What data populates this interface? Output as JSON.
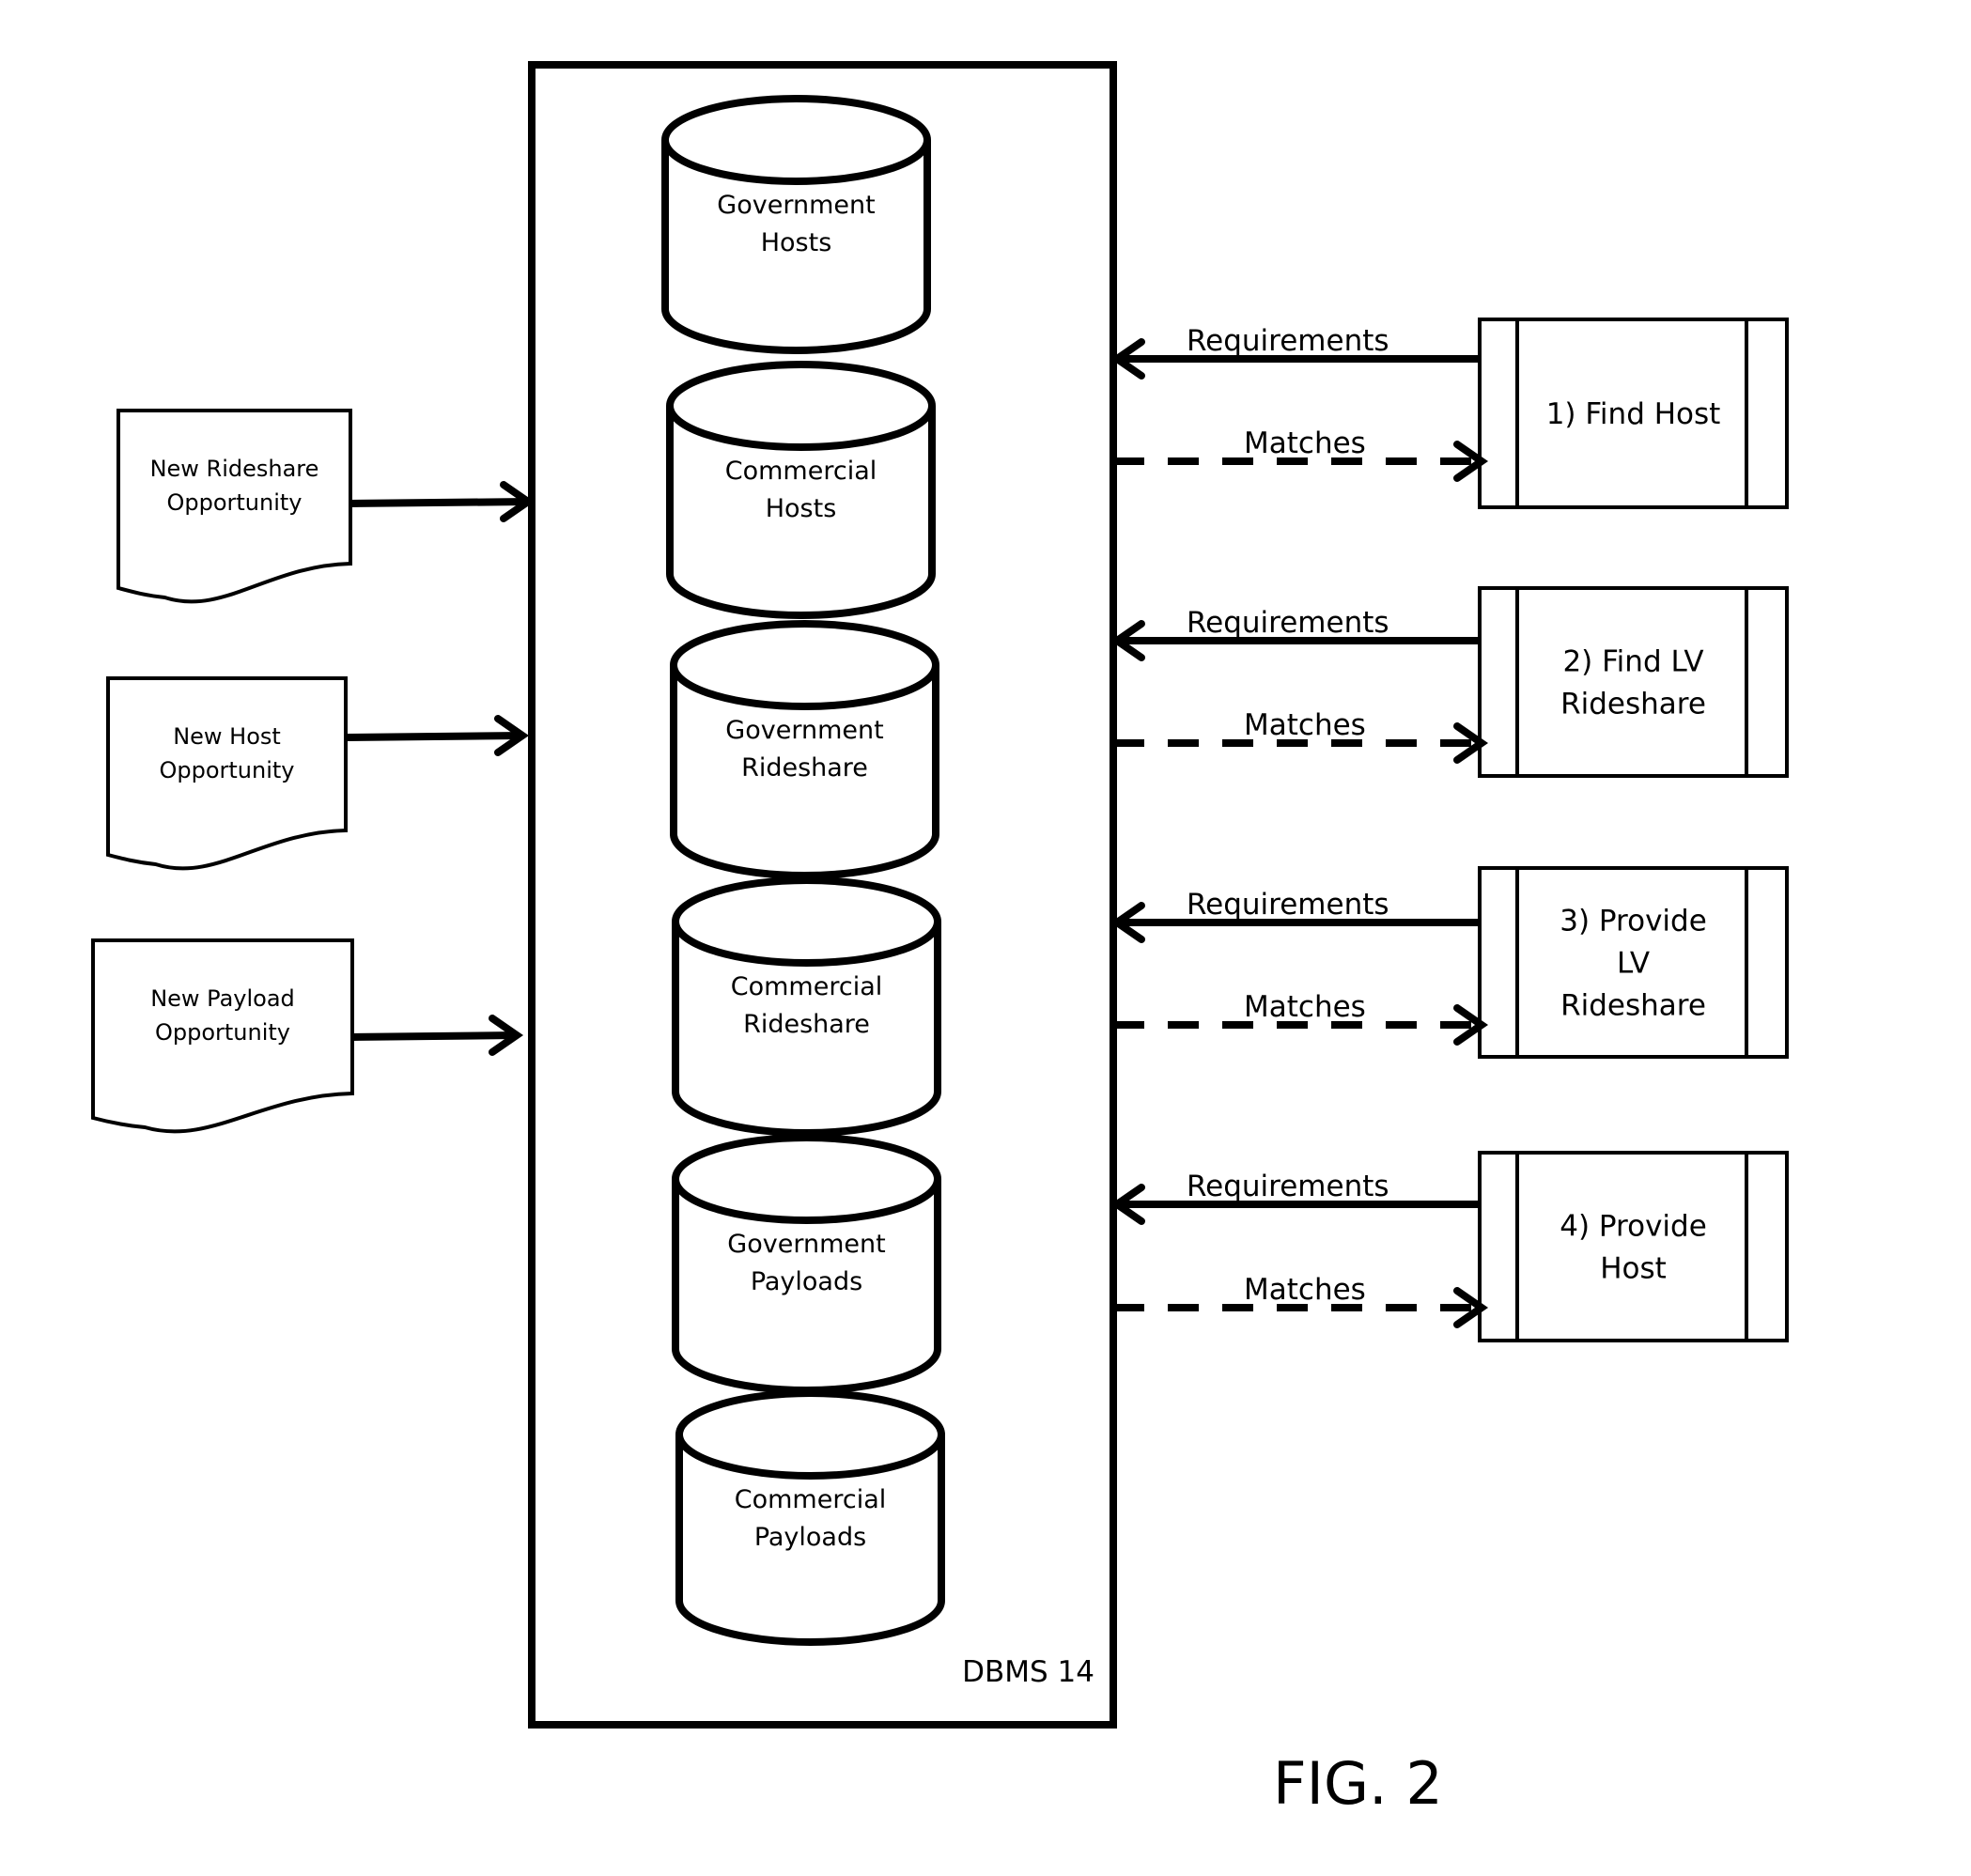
{
  "figure_label": "FIG. 2",
  "dbms": {
    "label": "DBMS 14",
    "databases": [
      {
        "name": "Government Hosts",
        "lines": [
          "Government",
          "Hosts"
        ]
      },
      {
        "name": "Commercial Hosts",
        "lines": [
          "Commercial",
          "Hosts"
        ]
      },
      {
        "name": "Government Rideshare",
        "lines": [
          "Government",
          "Rideshare"
        ]
      },
      {
        "name": "Commercial Rideshare",
        "lines": [
          "Commercial",
          "Rideshare"
        ]
      },
      {
        "name": "Government Payloads",
        "lines": [
          "Government",
          "Payloads"
        ]
      },
      {
        "name": "Commercial Payloads",
        "lines": [
          "Commercial",
          "Payloads"
        ]
      }
    ]
  },
  "inputs": [
    {
      "name": "New Rideshare Opportunity",
      "lines": [
        "New Rideshare",
        "Opportunity"
      ]
    },
    {
      "name": "New Host Opportunity",
      "lines": [
        "New Host",
        "Opportunity"
      ]
    },
    {
      "name": "New Payload Opportunity",
      "lines": [
        "New Payload",
        "Opportunity"
      ]
    }
  ],
  "processes": [
    {
      "name": "1) Find Host",
      "lines": [
        "1) Find Host"
      ],
      "requirements_label": "Requirements",
      "matches_label": "Matches"
    },
    {
      "name": "2) Find LV Rideshare",
      "lines": [
        "2) Find LV",
        "Rideshare"
      ],
      "requirements_label": "Requirements",
      "matches_label": "Matches"
    },
    {
      "name": "3) Provide LV Rideshare",
      "lines": [
        "3) Provide",
        "LV",
        "Rideshare"
      ],
      "requirements_label": "Requirements",
      "matches_label": "Matches"
    },
    {
      "name": "4) Provide Host",
      "lines": [
        "4) Provide",
        "Host"
      ],
      "requirements_label": "Requirements",
      "matches_label": "Matches"
    }
  ]
}
